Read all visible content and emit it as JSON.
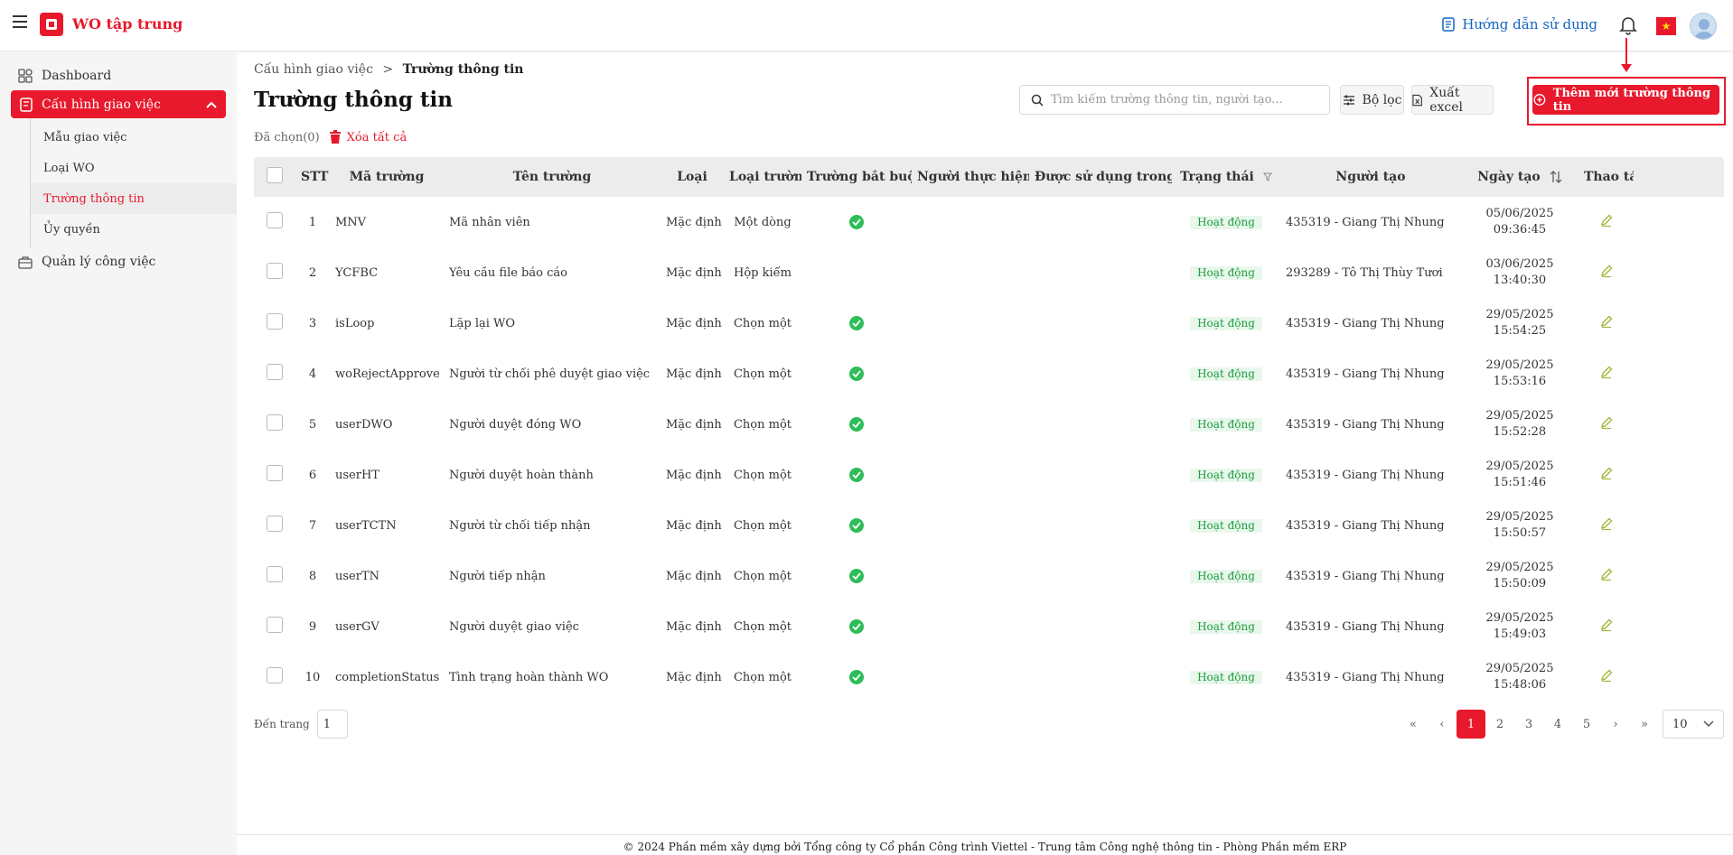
{
  "header": {
    "app_title": "WO tập trung",
    "guide_label": "Hướng dẫn sử dụng",
    "flag_star": "★"
  },
  "sidebar": {
    "dashboard": "Dashboard",
    "config": "Cấu hình giao việc",
    "sub": [
      "Mẫu giao việc",
      "Loại WO",
      "Trường thông tin",
      "Ủy quyền"
    ],
    "manage": "Quản lý công việc"
  },
  "breadcrumb": {
    "parent": "Cấu hình giao việc",
    "sep": ">",
    "current": "Trường thông tin"
  },
  "page_title": "Trường thông tin",
  "toolbar": {
    "search_placeholder": "Tìm kiếm trường thông tin, người tạo...",
    "filter": "Bộ lọc",
    "export": "Xuất excel",
    "add": "Thêm mới trường thông tin"
  },
  "selection": {
    "selected": "Đã chọn(0)",
    "delete_all": "Xóa tất cả"
  },
  "table": {
    "headers": [
      "STT",
      "Mã trường",
      "Tên trường",
      "Loại",
      "Loại trường",
      "Trường bắt buộc",
      "Người thực hiện",
      "Được sử dụng trong MGV",
      "Trạng thái",
      "Người tạo",
      "Ngày tạo",
      "Thao tác"
    ],
    "rows": [
      {
        "stt": "1",
        "code": "MNV",
        "name": "Mã nhân viên",
        "type": "Mặc định",
        "ftype": "Một dòng",
        "required": true,
        "status": "Hoạt động",
        "creator": "435319 - Giang Thị Nhung",
        "date": "05/06/2025",
        "time": "09:36:45"
      },
      {
        "stt": "2",
        "code": "YCFBC",
        "name": "Yêu cầu file báo cáo",
        "type": "Mặc định",
        "ftype": "Hộp kiểm",
        "required": false,
        "status": "Hoạt động",
        "creator": "293289 - Tô Thị Thùy Tươi",
        "date": "03/06/2025",
        "time": "13:40:30"
      },
      {
        "stt": "3",
        "code": "isLoop",
        "name": "Lặp lại WO",
        "type": "Mặc định",
        "ftype": "Chọn một",
        "required": true,
        "status": "Hoạt động",
        "creator": "435319 - Giang Thị Nhung",
        "date": "29/05/2025",
        "time": "15:54:25"
      },
      {
        "stt": "4",
        "code": "woRejectApprove",
        "name": "Người từ chối phê duyệt giao việc",
        "type": "Mặc định",
        "ftype": "Chọn một",
        "required": true,
        "status": "Hoạt động",
        "creator": "435319 - Giang Thị Nhung",
        "date": "29/05/2025",
        "time": "15:53:16"
      },
      {
        "stt": "5",
        "code": "userDWO",
        "name": "Người duyệt đóng WO",
        "type": "Mặc định",
        "ftype": "Chọn một",
        "required": true,
        "status": "Hoạt động",
        "creator": "435319 - Giang Thị Nhung",
        "date": "29/05/2025",
        "time": "15:52:28"
      },
      {
        "stt": "6",
        "code": "userHT",
        "name": "Người duyệt hoàn thành",
        "type": "Mặc định",
        "ftype": "Chọn một",
        "required": true,
        "status": "Hoạt động",
        "creator": "435319 - Giang Thị Nhung",
        "date": "29/05/2025",
        "time": "15:51:46"
      },
      {
        "stt": "7",
        "code": "userTCTN",
        "name": "Người từ chối tiếp nhận",
        "type": "Mặc định",
        "ftype": "Chọn một",
        "required": true,
        "status": "Hoạt động",
        "creator": "435319 - Giang Thị Nhung",
        "date": "29/05/2025",
        "time": "15:50:57"
      },
      {
        "stt": "8",
        "code": "userTN",
        "name": "Người tiếp nhận",
        "type": "Mặc định",
        "ftype": "Chọn một",
        "required": true,
        "status": "Hoạt động",
        "creator": "435319 - Giang Thị Nhung",
        "date": "29/05/2025",
        "time": "15:50:09"
      },
      {
        "stt": "9",
        "code": "userGV",
        "name": "Người duyệt giao việc",
        "type": "Mặc định",
        "ftype": "Chọn một",
        "required": true,
        "status": "Hoạt động",
        "creator": "435319 - Giang Thị Nhung",
        "date": "29/05/2025",
        "time": "15:49:03"
      },
      {
        "stt": "10",
        "code": "completionStatus",
        "name": "Tình trạng hoàn thành WO",
        "type": "Mặc định",
        "ftype": "Chọn một",
        "required": true,
        "status": "Hoạt động",
        "creator": "435319 - Giang Thị Nhung",
        "date": "29/05/2025",
        "time": "15:48:06"
      }
    ]
  },
  "pagination": {
    "goto_label": "Đến trang",
    "goto_value": "1",
    "first": "«",
    "prev": "‹",
    "pages": [
      "1",
      "2",
      "3",
      "4",
      "5"
    ],
    "next": "›",
    "last": "»",
    "page_size": "10"
  },
  "footer": "© 2024 Phần mềm xây dựng bởi Tổng công ty Cổ phần Công trình Viettel - Trung tâm Công nghệ thông tin - Phòng Phần mềm ERP",
  "colors": {
    "brand": "#e8192c",
    "success": "#2ebd59",
    "link": "#1565c0"
  }
}
